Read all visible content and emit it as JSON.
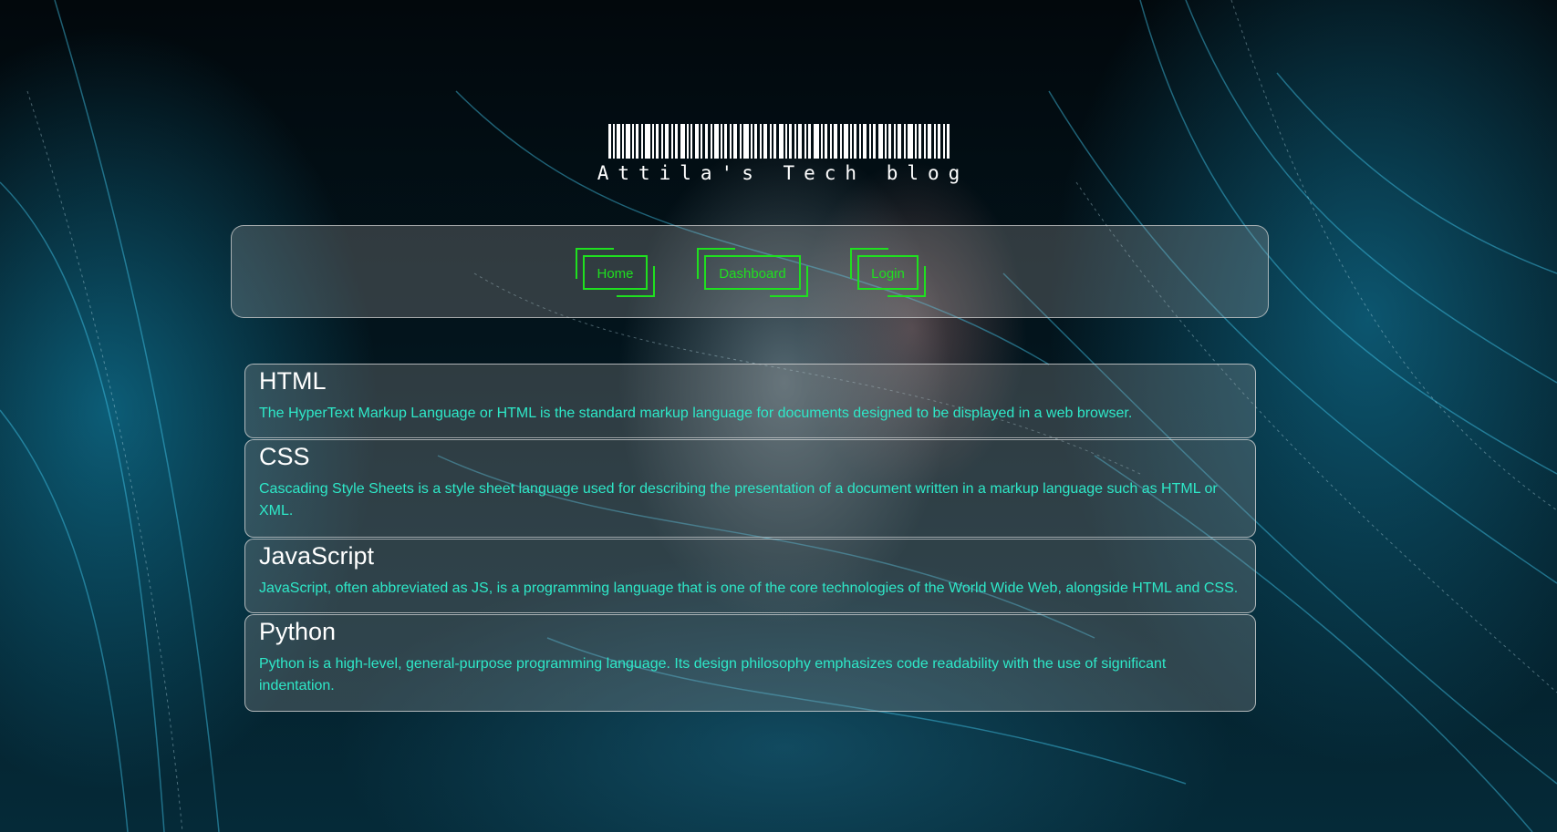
{
  "site": {
    "title": "Attila's Tech blog"
  },
  "nav": {
    "home": "Home",
    "dashboard": "Dashboard",
    "login": "Login"
  },
  "posts": [
    {
      "title": "HTML",
      "body": "The HyperText Markup Language or HTML is the standard markup language for documents designed to be displayed in a web browser."
    },
    {
      "title": "CSS",
      "body": "Cascading Style Sheets is a style sheet language used for describing the presentation of a document written in a markup language such as HTML or XML."
    },
    {
      "title": "JavaScript",
      "body": "JavaScript, often abbreviated as JS, is a programming language that is one of the core technologies of the World Wide Web, alongside HTML and CSS."
    },
    {
      "title": "Python",
      "body": "Python is a high-level, general-purpose programming language. Its design philosophy emphasizes code readability with the use of significant indentation."
    }
  ],
  "colors": {
    "accent_green": "#1fe01f",
    "post_text": "#2ee8c8",
    "heading_text": "#ffffff"
  },
  "icons": {
    "logo": "barcode-logo-icon"
  }
}
